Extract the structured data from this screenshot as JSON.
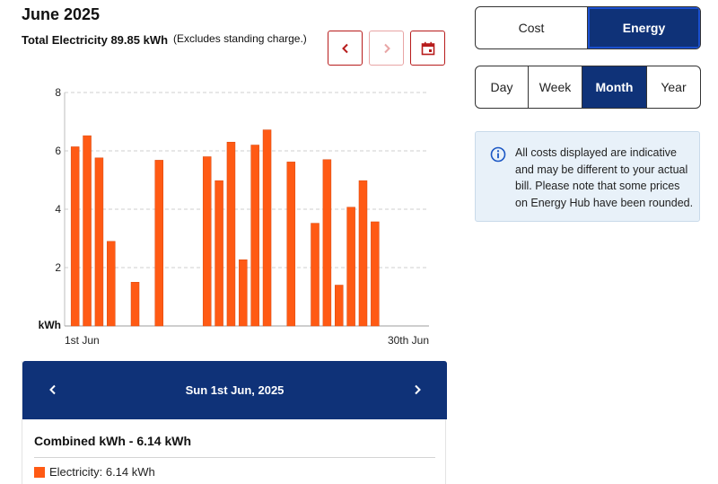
{
  "header": {
    "title": "June 2025",
    "total_label": "Total Electricity 89.85 kWh",
    "note": "(Excludes standing charge.)"
  },
  "nav": {
    "prev_icon": "chevron-left-icon",
    "next_icon": "chevron-right-icon",
    "calendar_icon": "calendar-icon",
    "next_disabled": true
  },
  "toggle": {
    "options": [
      "Cost",
      "Energy"
    ],
    "selected": "Energy"
  },
  "period": {
    "options": [
      "Day",
      "Week",
      "Month",
      "Year"
    ],
    "selected": "Month"
  },
  "info": {
    "icon": "info-icon",
    "text": "All costs displayed are indicative and may be different to your actual bill. Please note that some prices on Energy Hub have been rounded."
  },
  "chart_data": {
    "type": "bar",
    "ylabel": "kWh",
    "ylim": [
      0,
      8
    ],
    "yticks": [
      2,
      4,
      6,
      8
    ],
    "grid": true,
    "x_first_label": "1st Jun",
    "x_last_label": "30th Jun",
    "categories": [
      "1",
      "2",
      "3",
      "4",
      "5",
      "6",
      "7",
      "8",
      "9",
      "10",
      "11",
      "12",
      "13",
      "14",
      "15",
      "16",
      "17",
      "18",
      "19",
      "20",
      "21",
      "22",
      "23",
      "24",
      "25",
      "26",
      "27",
      "28",
      "29",
      "30"
    ],
    "values": [
      6.14,
      6.52,
      5.76,
      2.9,
      0,
      1.5,
      0,
      5.68,
      0,
      0,
      0,
      5.8,
      4.98,
      6.3,
      2.27,
      6.2,
      6.72,
      0,
      5.62,
      0,
      3.52,
      5.7,
      1.4,
      4.07,
      4.98,
      3.57,
      0,
      0,
      0,
      0
    ],
    "bar_color": "#ff5a14"
  },
  "detail": {
    "date": "Sun 1st Jun, 2025",
    "combined": "Combined kWh - 6.14 kWh",
    "electricity": "Electricity: 6.14 kWh",
    "swatch_color": "#ff5a14"
  }
}
